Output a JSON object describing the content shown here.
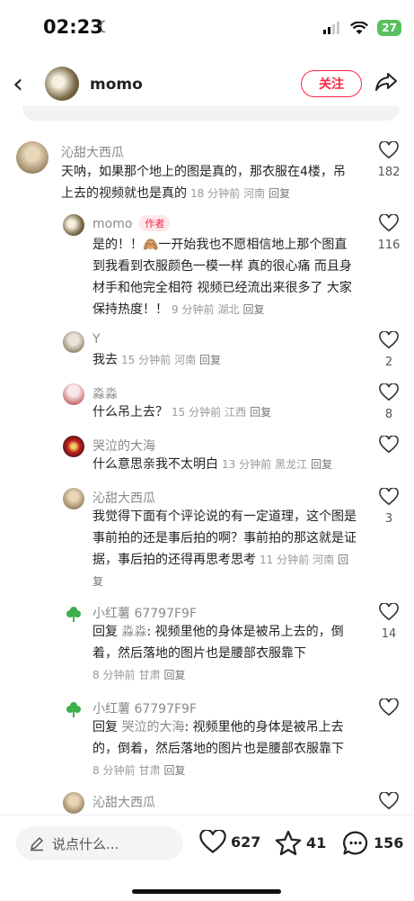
{
  "status_bar": {
    "time": "02:23",
    "battery": "27"
  },
  "header": {
    "author": "momo",
    "follow_label": "关注"
  },
  "comments": [
    {
      "name": "沁甜大西瓜",
      "text": "天呐，如果那个地上的图是真的，那衣服在4楼，吊上去的视频就也是真的",
      "time": "18 分钟前",
      "loc": "河南",
      "reply": "回复",
      "likes": "182"
    },
    {
      "name": "momo",
      "tag": "作者",
      "text": "是的！！🙈一开始我也不愿相信地上那个图直到我看到衣服颜色一模一样 真的很心痛 而且身材手和他完全相符 视频已经流出来很多了  大家保持热度！！",
      "time": "9 分钟前",
      "loc": "湖北",
      "reply": "回复",
      "likes": "116"
    },
    {
      "name": "Y",
      "text": "我去",
      "time": "15 分钟前",
      "loc": "河南",
      "reply": "回复",
      "likes": "2"
    },
    {
      "name": "淼淼",
      "text": "什么吊上去？",
      "time": "15 分钟前",
      "loc": "江西",
      "reply": "回复",
      "likes": "8"
    },
    {
      "name": "哭泣的大海",
      "text": "什么意思亲我不太明白",
      "time": "13 分钟前",
      "loc": "黑龙江",
      "reply": "回复",
      "likes": ""
    },
    {
      "name": "沁甜大西瓜",
      "text": "我觉得下面有个评论说的有一定道理，这个图是事前拍的还是事后拍的啊？事前拍的那这就是证据，事后拍的还得再思考思考",
      "time": "11 分钟前",
      "loc": "河南",
      "reply": "回复",
      "likes": "3"
    },
    {
      "name": "小红薯 67797F9F",
      "prefix": "回复",
      "ref": "淼淼",
      "text": ": 视频里他的身体是被吊上去的，倒着，然后落地的图片也是腰部衣服靠下",
      "time": "8 分钟前",
      "loc": "甘肃",
      "reply": "回复",
      "likes": "14"
    },
    {
      "name": "小红薯 67797F9F",
      "prefix": "回复",
      "ref": "哭泣的大海",
      "text": ": 视频里他的身体是被吊上去的，倒着，然后落地的图片也是腰部衣服靠下",
      "time": "8 分钟前",
      "loc": "甘肃",
      "reply": "回复",
      "likes": ""
    },
    {
      "name": "沁甜大西瓜"
    }
  ],
  "bottom_bar": {
    "placeholder": "说点什么...",
    "likes": "627",
    "stars": "41",
    "comments": "156"
  },
  "colors": {
    "accent": "#ff2442",
    "meta": "#999999"
  }
}
